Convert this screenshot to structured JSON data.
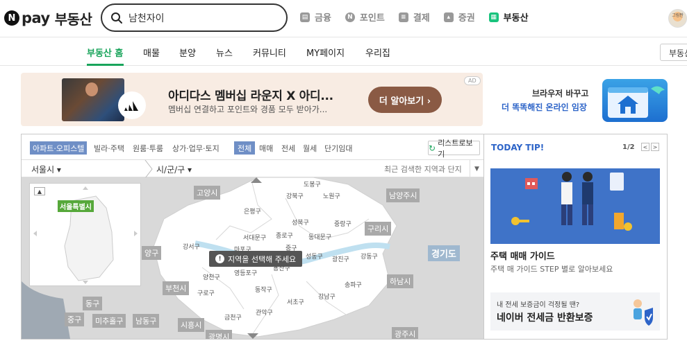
{
  "header": {
    "logo_badge": "N",
    "logo_pay": "pay",
    "service_name": "부동산",
    "search": {
      "value": "남천자이",
      "placeholder": ""
    },
    "services": [
      {
        "label": "금융",
        "icon": "bank-icon"
      },
      {
        "label": "포인트",
        "icon": "point-icon"
      },
      {
        "label": "결제",
        "icon": "receipt-icon"
      },
      {
        "label": "증권",
        "icon": "stock-icon"
      },
      {
        "label": "부동산",
        "icon": "building-icon",
        "active": true
      }
    ],
    "avatar_text": "그림판"
  },
  "subnav": {
    "items": [
      "부동산 홈",
      "매물",
      "분양",
      "뉴스",
      "커뮤니티",
      "MY페이지",
      "우리집"
    ],
    "right_button": "부동산"
  },
  "ad": {
    "title": "아디다스 멤버십 라운지 X 아디...",
    "subtitle": "멤버십 연결하고 포인트와 경품 모두 받아가...",
    "button": "더 알아보기 ›",
    "tag": "AD"
  },
  "promo": {
    "line1": "브라우저 바꾸고",
    "line2": "더 똑똑해진 온라인 임장"
  },
  "map": {
    "filters": {
      "property_types": [
        "아파트·오피스텔",
        "빌라·주택",
        "원룸·투룸",
        "상가·업무·토지"
      ],
      "deal_types": [
        "전체",
        "매매",
        "전세",
        "월세",
        "단기임대"
      ]
    },
    "list_button": "리스트로보기",
    "region_city": "서울시 ▾",
    "region_district": "시/군/구 ▾",
    "recent_search": "최근 검색한 지역과 단지",
    "recent_arrow": "▼",
    "minimap_label": "서울특별시",
    "minimap_collapse": "▲",
    "tip": "지역을 선택해 주세요",
    "tip_icon": "!",
    "districts": [
      "도봉구",
      "강북구",
      "노원구",
      "은평구",
      "성북구",
      "중랑구",
      "서대문구",
      "종로구",
      "동대문구",
      "마포구",
      "중구",
      "강서구",
      "성동구",
      "광진구",
      "강동구",
      "용산구",
      "양천구",
      "영등포구",
      "동작구",
      "구로구",
      "서초구",
      "강남구",
      "송파구",
      "금천구",
      "관악구"
    ],
    "surrounding": [
      "고양시",
      "남양주시",
      "구리시",
      "하남시",
      "부천시",
      "시흥시",
      "광명시",
      "광주시",
      "중구",
      "동구",
      "미추홀구",
      "남동구",
      "양구"
    ],
    "province": "경기도"
  },
  "today_tip": {
    "title": "TODAY TIP!",
    "page": "1/2",
    "prev": "<",
    "next": ">",
    "headline": "주택 매매 가이드",
    "description": "주택 매 가이드 STEP 별로 알아보세요",
    "card_small": "내 전세 보증금이 걱정될 땐?",
    "card_big": "네이버 전세금 반환보증"
  },
  "colors": {
    "brand_green": "#19a45b",
    "selected_chip": "#6f8fc6",
    "promo_blue": "#2d64c8",
    "ad_button": "#8a5a44"
  }
}
